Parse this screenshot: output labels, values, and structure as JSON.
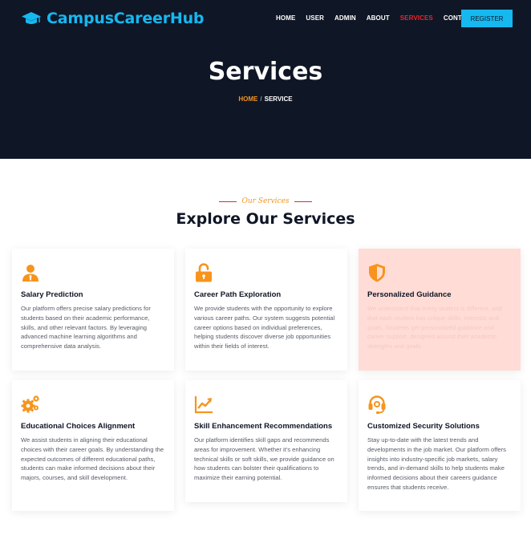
{
  "header": {
    "brand": "CampusCareerHub",
    "nav": [
      "HOME",
      "USER",
      "ADMIN",
      "ABOUT",
      "SERVICES",
      "CONTACT"
    ],
    "active_nav": "SERVICES",
    "register_label": "REGISTER",
    "brand_color": "#16b8f0",
    "active_color": "#e8262b"
  },
  "hero": {
    "title": "Services",
    "breadcrumb_home": "HOME",
    "breadcrumb_sep": "/",
    "breadcrumb_current": "SERVICE"
  },
  "section": {
    "tag": "Our Services",
    "title": "Explore Our Services"
  },
  "services": [
    {
      "icon": "user-tie-icon",
      "title": "Salary Prediction",
      "desc": "Our platform offers precise salary predictions for students based on their academic performance, skills, and other relevant factors. By leveraging advanced machine learning algorithms and comprehensive data analysis."
    },
    {
      "icon": "unlock-icon",
      "title": "Career Path Exploration",
      "desc": "We provide students with the opportunity to explore various career paths. Our system suggests potential career options based on individual preferences, helping students discover diverse job opportunities within their fields of interest."
    },
    {
      "icon": "shield-icon",
      "title": "Personalized Guidance",
      "desc": "We understand that every student is different, and that each student has unique skills, interests and goals. Students get personalized guidance and career support, designed around their academic strengths and goals."
    },
    {
      "icon": "gears-icon",
      "title": "Educational Choices Alignment",
      "desc": "We assist students in aligning their educational choices with their career goals. By understanding the expected outcomes of different educational paths, students can make informed decisions about their majors, courses, and skill development."
    },
    {
      "icon": "chart-line-icon",
      "title": "Skill Enhancement Recommendations",
      "desc": "Our platform identifies skill gaps and recommends areas for improvement. Whether it's enhancing technical skills or soft skills, we provide guidance on how students can bolster their qualifications to maximize their earning potential."
    },
    {
      "icon": "headset-icon",
      "title": "Customized Security Solutions",
      "desc": "Stay up-to-date with the latest trends and developments in the job market. Our platform offers insights into industry-specific job markets, salary trends, and in-demand skills to help students make informed decisions about their careers guidance ensures that students receive."
    }
  ],
  "colors": {
    "dark": "#0f1626",
    "accent_orange": "#f7941d",
    "highlight_card": "#ffdcd6"
  }
}
